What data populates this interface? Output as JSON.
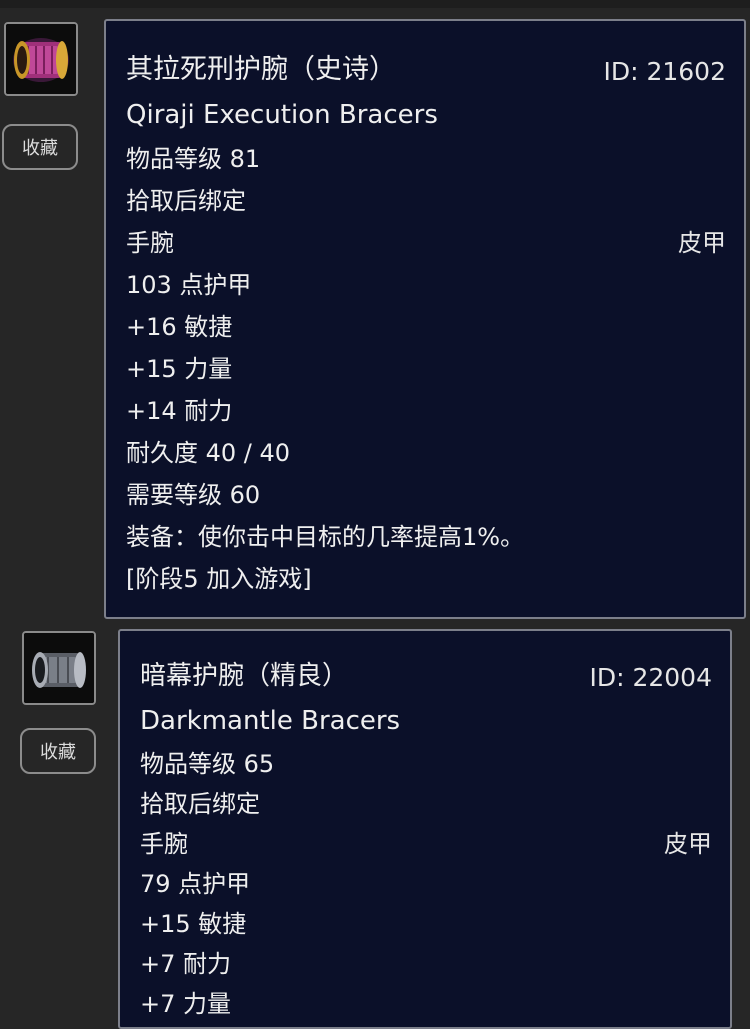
{
  "colors": {
    "background": "#262626",
    "card_bg": "#0b1029",
    "epic": "#b44fe6",
    "rare": "#2f8fe6",
    "item_level": "#f0c020",
    "equip_effect": "#22e022",
    "phase": "#e8b420"
  },
  "items": [
    {
      "icon": "bracer-epic-icon",
      "favorite_label": "收藏",
      "name_cn": "其拉死刑护腕（史诗）",
      "id": "ID: 21602",
      "name_en": "Qiraji Execution Bracers",
      "item_level": "物品等级 81",
      "binding": "拾取后绑定",
      "slot": "手腕",
      "armor_type": "皮甲",
      "armor": "103 点护甲",
      "stats": [
        "+16 敏捷",
        "+15 力量",
        "+14 耐力"
      ],
      "durability": "耐久度 40 / 40",
      "required_level": "需要等级 60",
      "equip": "装备：使你击中目标的几率提高1%。",
      "phase": "[阶段5 加入游戏]"
    },
    {
      "icon": "bracer-rare-icon",
      "favorite_label": "收藏",
      "name_cn": "暗幕护腕（精良）",
      "id": "ID: 22004",
      "name_en": "Darkmantle Bracers",
      "item_level": "物品等级 65",
      "binding": "拾取后绑定",
      "slot": "手腕",
      "armor_type": "皮甲",
      "armor": "79 点护甲",
      "stats": [
        "+15 敏捷",
        "+7 耐力",
        "+7 力量"
      ]
    }
  ]
}
